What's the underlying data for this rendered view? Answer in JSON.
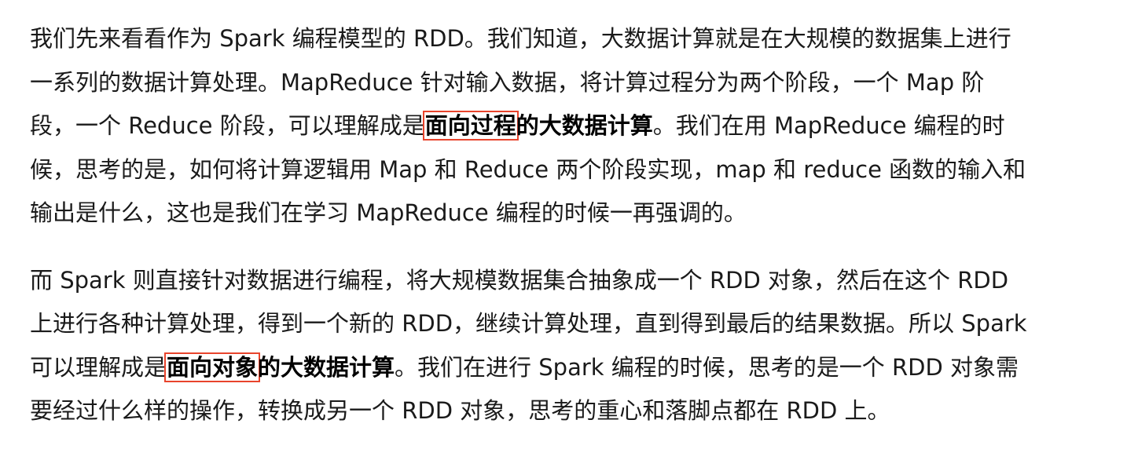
{
  "article": {
    "p1": {
      "l1": "我们先来看看作为 Spark 编程模型的 RDD。我们知道，大数据计算就是在大规模的数据集上进行",
      "l2": "一系列的数据计算处理。MapReduce 针对输入数据，将计算过程分为两个阶段，一个 Map 阶",
      "l3_pre": "段，一个 Reduce 阶段，可以理解成是",
      "l3_hl": "面向过程",
      "l3_strong": "的大数据计算",
      "l3_post": "。我们在用 MapReduce 编程的时",
      "l4": "候，思考的是，如何将计算逻辑用 Map 和 Reduce 两个阶段实现，map 和 reduce 函数的输入和",
      "l5": "输出是什么，这也是我们在学习 MapReduce 编程的时候一再强调的。"
    },
    "p2": {
      "l1": "而 Spark 则直接针对数据进行编程，将大规模数据集合抽象成一个 RDD 对象，然后在这个 RDD",
      "l2": "上进行各种计算处理，得到一个新的 RDD，继续计算处理，直到得到最后的结果数据。所以 Spark",
      "l3_pre": "可以理解成是",
      "l3_hl": "面向对象",
      "l3_strong": "的大数据计算",
      "l3_post": "。我们在进行 Spark 编程的时候，思考的是一个 RDD 对象需",
      "l4": "要经过什么样的操作，转换成另一个 RDD 对象，思考的重心和落脚点都在 RDD 上。"
    }
  },
  "colors": {
    "text": "#1a1a1a",
    "highlight_box": "#e8442c"
  }
}
